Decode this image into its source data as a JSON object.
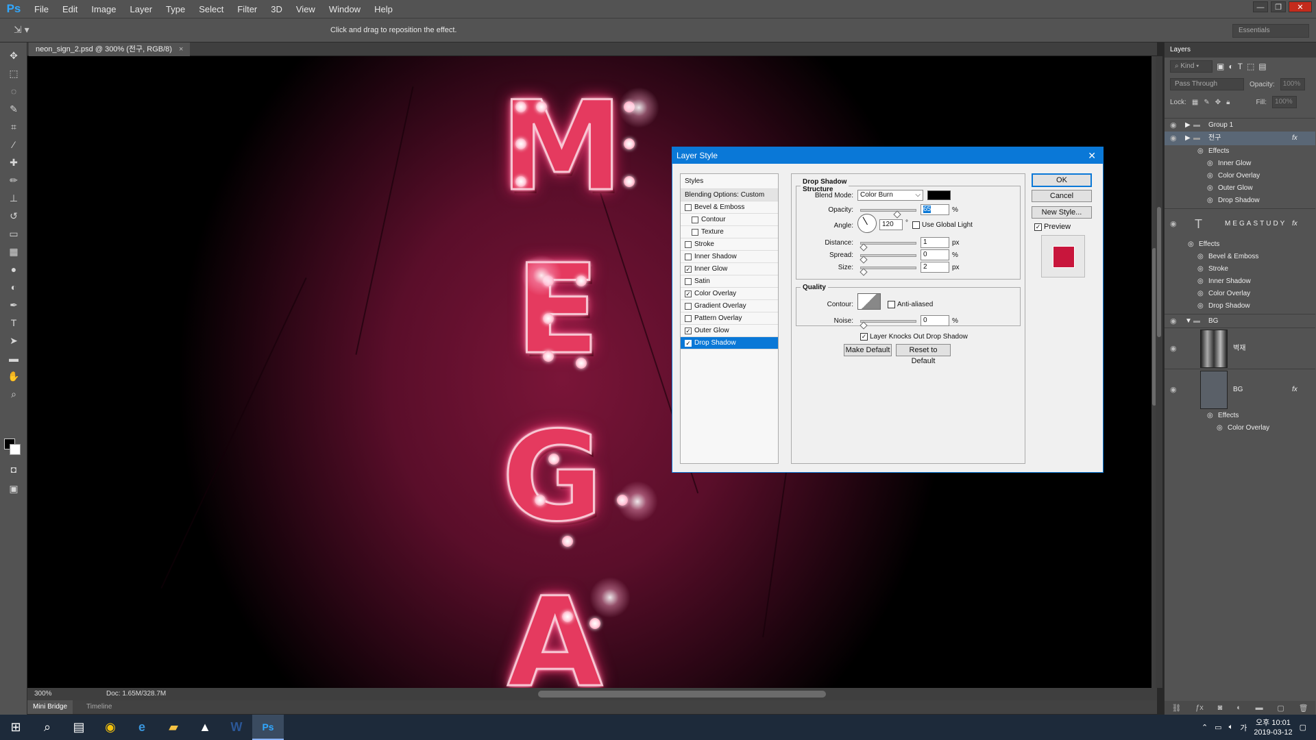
{
  "menubar": {
    "logo": "Ps",
    "items": [
      "File",
      "Edit",
      "Image",
      "Layer",
      "Type",
      "Select",
      "Filter",
      "3D",
      "View",
      "Window",
      "Help"
    ]
  },
  "optionsbar": {
    "hint": "Click and drag to reposition the effect.",
    "workspace": "Essentials"
  },
  "document": {
    "tab_title": "neon_sign_2.psd @ 300% (전구, RGB/8)",
    "letters": [
      "M",
      "E",
      "G",
      "A"
    ],
    "status_zoom": "300%",
    "status_doc": "Doc: 1.65M/328.7M"
  },
  "bottom_tabs": {
    "mini_bridge": "Mini Bridge",
    "timeline": "Timeline"
  },
  "layers_panel": {
    "title": "Layers",
    "kind": "Kind",
    "blend_mode": "Pass Through",
    "opacity_label": "Opacity:",
    "opacity_value": "100%",
    "lock_label": "Lock:",
    "fill_label": "Fill:",
    "fill_value": "100%",
    "group1": "Group 1",
    "selected_group": "전구",
    "effects_label": "Effects",
    "selected_effects": [
      "Inner Glow",
      "Color Overlay",
      "Outer Glow",
      "Drop Shadow"
    ],
    "text_layer": "MEGASTUDY",
    "text_effects": [
      "Bevel & Emboss",
      "Stroke",
      "Inner Shadow",
      "Color Overlay",
      "Drop Shadow"
    ],
    "bg_group": "BG",
    "layer_byeokjae": "벽재",
    "layer_bg": "BG",
    "bg_effects": [
      "Color Overlay"
    ],
    "fx": "fx"
  },
  "dialog": {
    "title": "Layer Style",
    "styles_header": "Styles",
    "blending_options": "Blending Options: Custom",
    "style_items": [
      {
        "label": "Bevel & Emboss",
        "checked": false,
        "indent": false
      },
      {
        "label": "Contour",
        "checked": false,
        "indent": true
      },
      {
        "label": "Texture",
        "checked": false,
        "indent": true
      },
      {
        "label": "Stroke",
        "checked": false,
        "indent": false
      },
      {
        "label": "Inner Shadow",
        "checked": false,
        "indent": false
      },
      {
        "label": "Inner Glow",
        "checked": true,
        "indent": false
      },
      {
        "label": "Satin",
        "checked": false,
        "indent": false
      },
      {
        "label": "Color Overlay",
        "checked": true,
        "indent": false
      },
      {
        "label": "Gradient Overlay",
        "checked": false,
        "indent": false
      },
      {
        "label": "Pattern Overlay",
        "checked": false,
        "indent": false
      },
      {
        "label": "Outer Glow",
        "checked": true,
        "indent": false
      },
      {
        "label": "Drop Shadow",
        "checked": true,
        "indent": false,
        "active": true
      }
    ],
    "section_title": "Drop Shadow",
    "structure": "Structure",
    "blend_mode_label": "Blend Mode:",
    "blend_mode_value": "Color Burn",
    "shadow_color": "#000000",
    "opacity_label": "Opacity:",
    "opacity_value": "65",
    "opacity_slider": 0.65,
    "percent": "%",
    "angle_label": "Angle:",
    "angle_value": "120",
    "degree": "°",
    "use_global_light": "Use Global Light",
    "distance_label": "Distance:",
    "distance_value": "1",
    "spread_label": "Spread:",
    "spread_value": "0",
    "size_label": "Size:",
    "size_value": "2",
    "px": "px",
    "quality": "Quality",
    "contour_label": "Contour:",
    "anti_aliased": "Anti-aliased",
    "noise_label": "Noise:",
    "noise_value": "0",
    "knocks_out": "Layer Knocks Out Drop Shadow",
    "make_default": "Make Default",
    "reset_default": "Reset to Default",
    "ok": "OK",
    "cancel": "Cancel",
    "new_style": "New Style...",
    "preview": "Preview",
    "preview_color": "#c8163c"
  },
  "taskbar": {
    "time_ampm": "오후 10:01",
    "date": "2019-03-12",
    "ime": "가"
  }
}
